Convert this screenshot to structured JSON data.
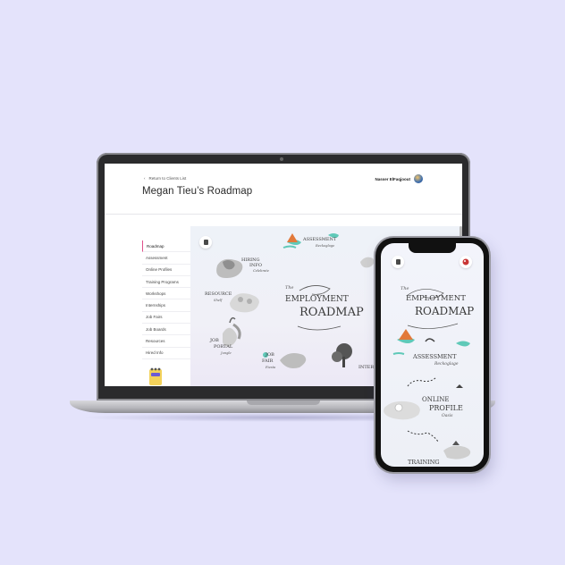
{
  "laptop": {
    "header": {
      "back_link": "Return to Clients List",
      "page_title": "Megan Tieu’s Roadmap",
      "user_name": "Nasser ElFaqjoout"
    },
    "sidebar": {
      "items": [
        {
          "label": "Roadmap",
          "active": true
        },
        {
          "label": "Assessment"
        },
        {
          "label": "Online Profiles"
        },
        {
          "label": "Training Programs"
        },
        {
          "label": "Workshops"
        },
        {
          "label": "Internships"
        },
        {
          "label": "Job Fairs"
        },
        {
          "label": "Job Boards"
        },
        {
          "label": "Resources"
        },
        {
          "label": "Hired Info"
        }
      ]
    },
    "map": {
      "hiring_info": {
        "line1": "Hiring",
        "line2": "Info",
        "sub": "Celebrate"
      },
      "assessment": {
        "title": "Assessment",
        "sub": "Reckoglage"
      },
      "employment": {
        "the": "The",
        "line1": "Employment",
        "line2": "Roadmap"
      },
      "resource": {
        "title": "Resource",
        "sub": "Shelf"
      },
      "job_portal": {
        "line1": "Job",
        "line2": "Portal",
        "sub": "Jungle"
      },
      "job_fair": {
        "line1": "Job",
        "line2": "Fair",
        "sub": "Fiesta"
      },
      "internship": {
        "title": "Intern"
      }
    }
  },
  "phone": {
    "employment": {
      "the": "The",
      "line1": "Employment",
      "line2": "Roadmap"
    },
    "assessment": {
      "title": "Assessment",
      "sub": "Reckoglage"
    },
    "online_profile": {
      "line1": "Online",
      "line2": "Profile",
      "sub": "Oasis"
    },
    "training": {
      "title": "Training"
    }
  },
  "colors": {
    "background": "#e4e3fb",
    "active_nav": "#e0518b",
    "island_teal": "#5fc9b8",
    "tent_orange": "#e2793a"
  }
}
